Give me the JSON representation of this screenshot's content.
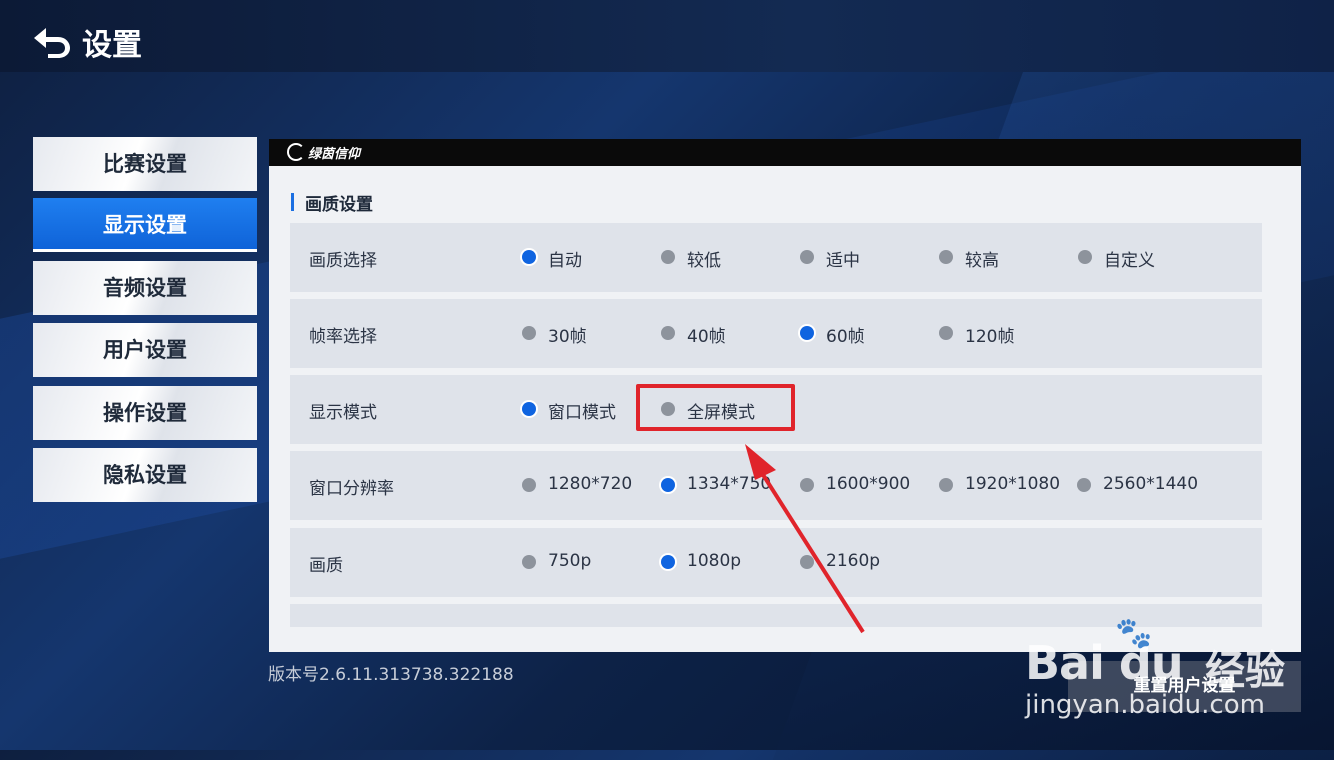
{
  "header": {
    "title": "设置"
  },
  "nav": {
    "items": [
      {
        "label": "比赛设置",
        "active": false
      },
      {
        "label": "显示设置",
        "active": true
      },
      {
        "label": "音频设置",
        "active": false
      },
      {
        "label": "用户设置",
        "active": false
      },
      {
        "label": "操作设置",
        "active": false
      },
      {
        "label": "隐私设置",
        "active": false
      }
    ]
  },
  "panel": {
    "logo": "绿茵信仰",
    "section_title": "画质设置",
    "rows": [
      {
        "label": "画质选择",
        "options": [
          "自动",
          "较低",
          "适中",
          "较高",
          "自定义"
        ],
        "selected": "自动"
      },
      {
        "label": "帧率选择",
        "options": [
          "30帧",
          "40帧",
          "60帧",
          "120帧"
        ],
        "selected": "60帧"
      },
      {
        "label": "显示模式",
        "options": [
          "窗口模式",
          "全屏模式"
        ],
        "selected": "窗口模式"
      },
      {
        "label": "窗口分辨率",
        "options": [
          "1280*720",
          "1334*750",
          "1600*900",
          "1920*1080",
          "2560*1440"
        ],
        "selected": "1334*750"
      },
      {
        "label": "画质",
        "options": [
          "750p",
          "1080p",
          "2160p"
        ],
        "selected": "1080p"
      }
    ]
  },
  "footer": {
    "version": "版本号2.6.11.313738.322188",
    "reset_button": "重置用户设置"
  },
  "watermark": {
    "brand": "Bai du",
    "cn": "经验",
    "url": "jingyan.baidu.com"
  },
  "colors": {
    "accent": "#1b6fe2",
    "highlight": "#e0242b",
    "nav_active": "#1f7ff0"
  }
}
